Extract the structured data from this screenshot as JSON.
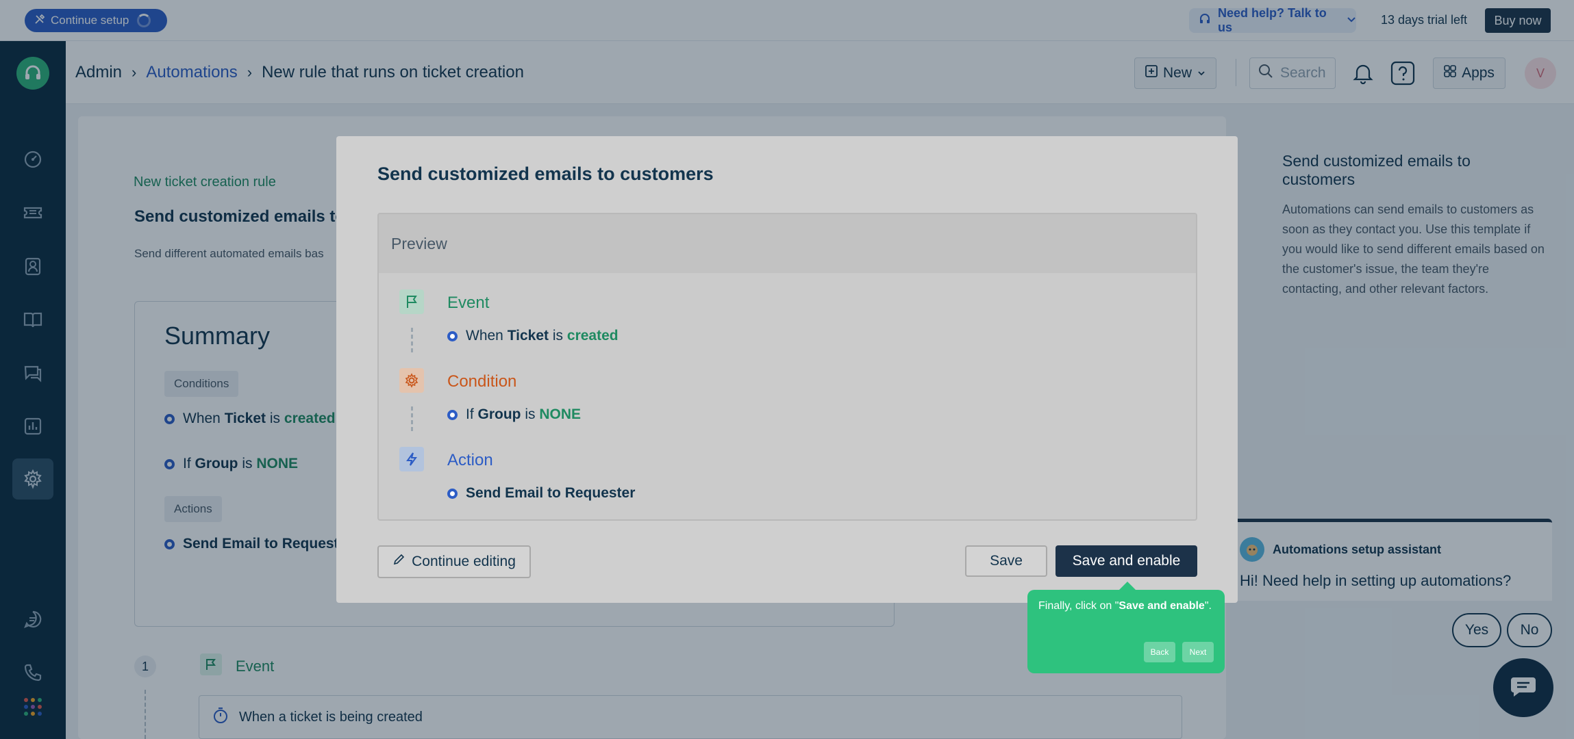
{
  "topbar": {
    "setup_label": "Continue setup",
    "help_label": "Need help? Talk to us",
    "trial_text": "13 days trial left",
    "buy_label": "Buy now"
  },
  "header": {
    "breadcrumb": [
      "Admin",
      "Automations",
      "New rule that runs on ticket creation"
    ],
    "new_label": "New",
    "search_placeholder": "Search",
    "apps_label": "Apps",
    "avatar_initial": "V"
  },
  "sidebar": {
    "items": [
      "dashboard-icon",
      "tickets-icon",
      "contacts-icon",
      "solutions-icon",
      "forums-icon",
      "analytics-icon",
      "admin-icon",
      "freshchat-icon",
      "phone-icon"
    ],
    "active": "admin-icon",
    "accent": "#2eb27a"
  },
  "page": {
    "rule_label": "New ticket creation rule",
    "rule_title": "Send customized emails to",
    "rule_desc": "Send different automated emails bas",
    "summary_title": "Summary",
    "conditions_tag": "Conditions",
    "actions_tag": "Actions",
    "summary_lines": [
      {
        "pre": "When",
        "subject": "Ticket",
        "op": "is",
        "value": "created"
      },
      {
        "pre": "If",
        "subject": "Group",
        "op": "is",
        "value": "NONE"
      }
    ],
    "summary_action": "Send Email to Requeste",
    "step_number": "1",
    "step_label": "Event",
    "trigger_text": "When a ticket is being created"
  },
  "right_panel": {
    "title": "Send customized emails to customers",
    "description": "Automations can send emails to customers as soon as they contact you. Use this template if you would like to send different emails based on the customer's issue, the team they're contacting, and other relevant factors."
  },
  "modal": {
    "title": "Send customized emails to customers",
    "preview_label": "Preview",
    "event": {
      "label": "Event",
      "pre": "When",
      "subject": "Ticket",
      "op": "is",
      "value": "created"
    },
    "condition": {
      "label": "Condition",
      "pre": "If",
      "subject": "Group",
      "op": "is",
      "value": "NONE"
    },
    "action": {
      "label": "Action",
      "text": "Send Email to Requester"
    },
    "continue_label": "Continue editing",
    "save_label": "Save",
    "save_enable_label": "Save and enable",
    "colors": {
      "event": "#1f8a61",
      "condition": "#c9561a",
      "action": "#2c5cc5"
    }
  },
  "coach": {
    "text_pre": "Finally, click on \"",
    "text_bold": "Save and enable",
    "text_post": "\".",
    "back_label": "Back",
    "next_label": "Next"
  },
  "assistant": {
    "title": "Automations setup assistant",
    "message": "Hi! Need help in setting up automations?",
    "yes_label": "Yes",
    "no_label": "No"
  }
}
